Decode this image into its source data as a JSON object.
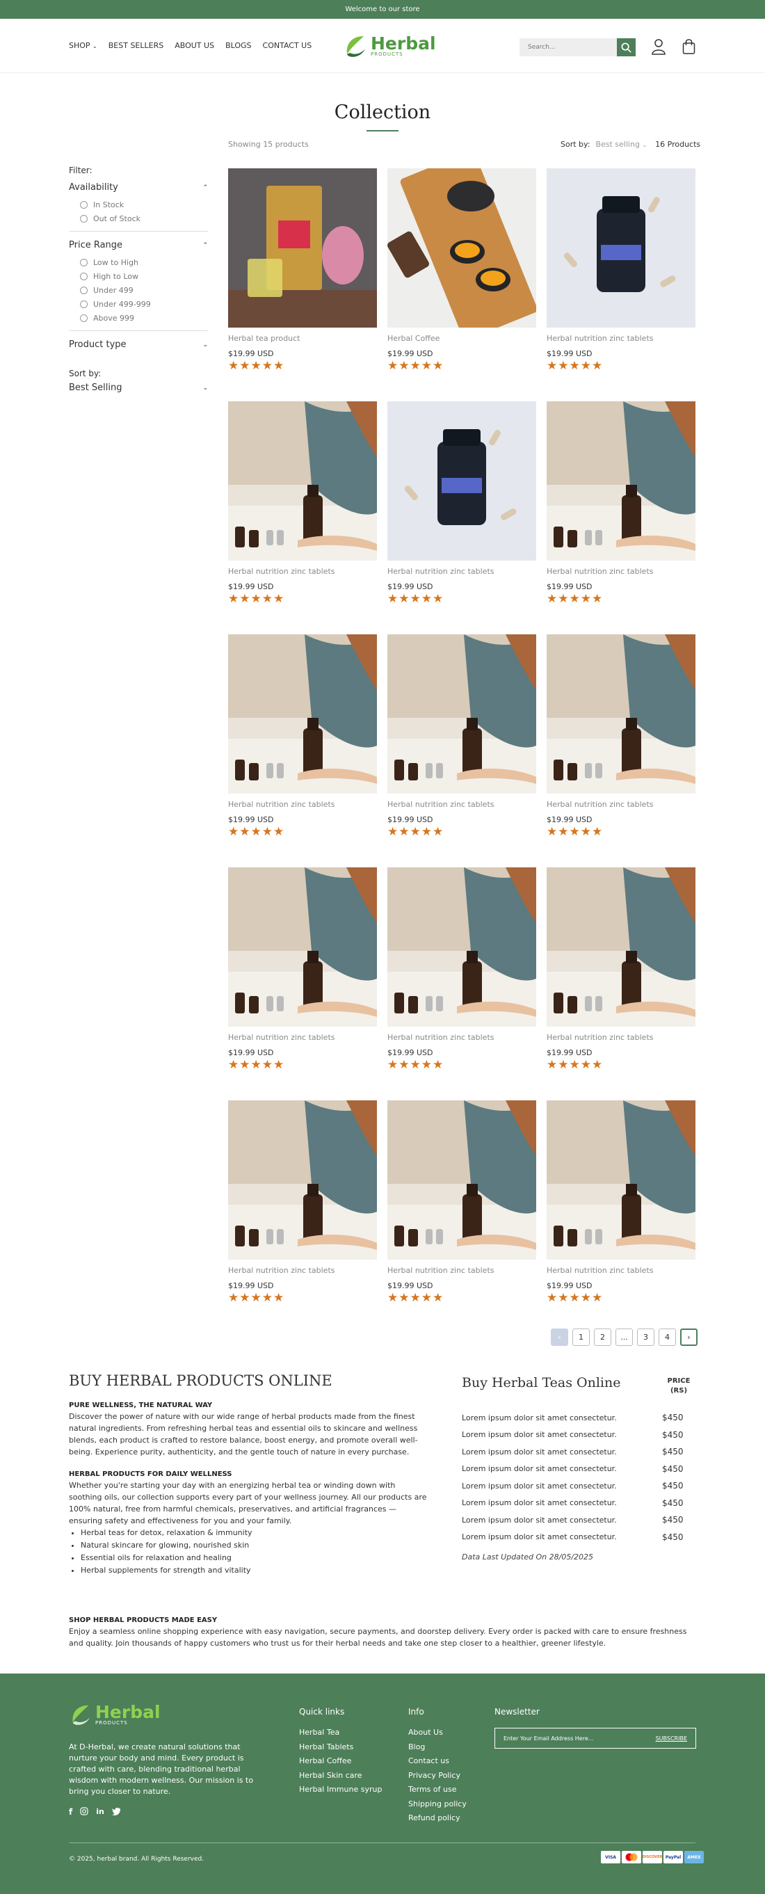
{
  "topbar": {
    "text": "Welcome to our store"
  },
  "nav": {
    "items": [
      "SHOP",
      "BEST SELLERS",
      "ABOUT US",
      "BLOGS",
      "CONTACT US"
    ]
  },
  "logo": {
    "name": "Herbal",
    "sub": "PRODUCTS"
  },
  "search": {
    "placeholder": "Search..."
  },
  "collection": {
    "title": "Collection",
    "showing": "Showing 15 products",
    "sort_label": "Sort by:",
    "sort_value": "Best selling",
    "count": "16 Products"
  },
  "filters": {
    "title": "Filter:",
    "availability": {
      "label": "Availability",
      "options": [
        "In Stock",
        "Out of Stock"
      ]
    },
    "price_range": {
      "label": "Price Range",
      "options": [
        "Low to High",
        "High to Low",
        "Under 499",
        "Under 499-999",
        "Above 999"
      ]
    },
    "product_type": {
      "label": "Product type"
    },
    "sort": {
      "label": "Sort by:",
      "value": "Best Selling"
    }
  },
  "products": [
    {
      "name": "Herbal tea product",
      "price": "$19.99 USD",
      "image": "tea"
    },
    {
      "name": "Herbal Coffee",
      "price": "$19.99 USD",
      "image": "cups"
    },
    {
      "name": "Herbal nutrition zinc tablets",
      "price": "$19.99 USD",
      "image": "bottle"
    },
    {
      "name": "Herbal nutrition zinc tablets",
      "price": "$19.99 USD",
      "image": "person"
    },
    {
      "name": "Herbal nutrition zinc tablets",
      "price": "$19.99 USD",
      "image": "bottle"
    },
    {
      "name": "Herbal nutrition zinc tablets",
      "price": "$19.99 USD",
      "image": "person"
    },
    {
      "name": "Herbal nutrition zinc tablets",
      "price": "$19.99 USD",
      "image": "person"
    },
    {
      "name": "Herbal nutrition zinc tablets",
      "price": "$19.99 USD",
      "image": "person"
    },
    {
      "name": "Herbal nutrition zinc tablets",
      "price": "$19.99 USD",
      "image": "person"
    },
    {
      "name": "Herbal nutrition zinc tablets",
      "price": "$19.99 USD",
      "image": "person"
    },
    {
      "name": "Herbal nutrition zinc tablets",
      "price": "$19.99 USD",
      "image": "person"
    },
    {
      "name": "Herbal nutrition zinc tablets",
      "price": "$19.99 USD",
      "image": "person"
    },
    {
      "name": "Herbal nutrition zinc tablets",
      "price": "$19.99 USD",
      "image": "person"
    },
    {
      "name": "Herbal nutrition zinc tablets",
      "price": "$19.99 USD",
      "image": "person"
    },
    {
      "name": "Herbal nutrition zinc tablets",
      "price": "$19.99 USD",
      "image": "person"
    }
  ],
  "rating": {
    "stars": 5,
    "max": 5,
    "color": "#d6761d"
  },
  "pagination": {
    "pages": [
      "1",
      "2",
      "...",
      "3",
      "4"
    ]
  },
  "info": {
    "title": "BUY HERBAL PRODUCTS ONLINE",
    "s1_head": "PURE WELLNESS, THE NATURAL WAY",
    "s1_text": "Discover the power of nature with our wide range of herbal products made from the finest natural ingredients. From refreshing herbal teas and essential oils to skincare and wellness blends, each product is crafted to restore balance, boost energy, and promote overall well-being. Experience purity, authenticity, and the gentle touch of nature in every purchase.",
    "s2_head": "HERBAL PRODUCTS FOR DAILY WELLNESS",
    "s2_text": "Whether you're starting your day with an energizing herbal tea or winding down with soothing oils, our collection supports every part of your wellness journey. All our products are 100% natural, free from harmful chemicals, preservatives, and artificial fragrances — ensuring safety and effectiveness for you and your family.",
    "s2_list": [
      "Herbal teas for detox, relaxation & immunity",
      "Natural skincare for glowing, nourished skin",
      "Essential oils for relaxation and healing",
      "Herbal supplements for strength and vitality"
    ],
    "s3_head": "SHOP HERBAL PRODUCTS MADE EASY",
    "s3_text": "Enjoy a seamless online shopping experience with easy navigation, secure payments, and doorstep delivery. Every order is packed with care to ensure freshness and quality. Join thousands of happy customers who trust us for their herbal needs and take one step closer to a healthier, greener lifestyle."
  },
  "teas": {
    "title": "Buy Herbal Teas Online",
    "price_head": "PRICE (RS)",
    "rows": [
      {
        "name": "Lorem ipsum dolor sit amet consectetur.",
        "price": "$450"
      },
      {
        "name": "Lorem ipsum dolor sit amet consectetur.",
        "price": "$450"
      },
      {
        "name": "Lorem ipsum dolor sit amet consectetur.",
        "price": "$450"
      },
      {
        "name": "Lorem ipsum dolor sit amet consectetur.",
        "price": "$450"
      },
      {
        "name": "Lorem ipsum dolor sit amet consectetur.",
        "price": "$450"
      },
      {
        "name": "Lorem ipsum dolor sit amet consectetur.",
        "price": "$450"
      },
      {
        "name": "Lorem ipsum dolor sit amet consectetur.",
        "price": "$450"
      },
      {
        "name": "Lorem ipsum dolor sit amet consectetur.",
        "price": "$450"
      }
    ],
    "updated": "Data Last Updated On 28/05/2025"
  },
  "footer": {
    "about": "At D-Herbal, we create natural solutions that nurture your body and mind. Every product is crafted with care, blending traditional herbal wisdom with modern wellness. Our mission is to bring you closer to nature.",
    "quick_title": "Quick links",
    "quick_links": [
      "Herbal Tea",
      "Herbal Tablets",
      "Herbal Coffee",
      "Herbal Skin care",
      "Herbal Immune syrup"
    ],
    "info_title": "Info",
    "info_links": [
      "About Us",
      "Blog",
      "Contact us",
      "Privacy Policy",
      "Terms of use",
      "Shipping policy",
      "Refund policy"
    ],
    "news_title": "Newsletter",
    "news_placeholder": "Enter Your Email Address Here...",
    "news_button": "SUBSCRIBE",
    "copyright": "© 2025, herbal brand. All Rights Reserved.",
    "payments": [
      "VISA",
      "MC",
      "DISCOVER",
      "PayPal",
      "AMEX"
    ]
  },
  "colors": {
    "brand": "#4d7f59",
    "star": "#d6761d",
    "logo_green": "#4d9a3f"
  }
}
